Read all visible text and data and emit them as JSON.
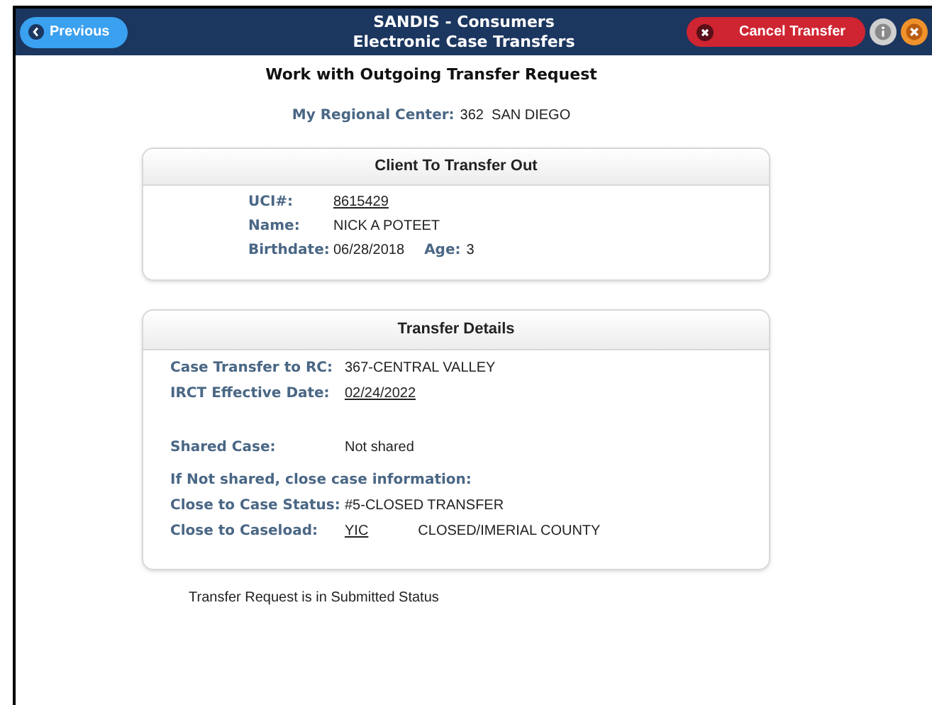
{
  "header": {
    "previous_button": "Previous",
    "title": "SANDIS - Consumers",
    "subtitle": "Electronic Case Transfers",
    "cancel_button": "Cancel Transfer"
  },
  "page_title": "Work with Outgoing Transfer Request",
  "regional_center": {
    "label": "My Regional Center:",
    "value": "362  SAN DIEGO"
  },
  "client_card": {
    "title": "Client To Transfer Out",
    "rows": [
      {
        "label": "UCI#:",
        "value": "8615429",
        "kind": "link"
      },
      {
        "label": "Name:",
        "value": "NICK A POTEET",
        "kind": "text"
      },
      {
        "label": "Birthdate:",
        "value": "06/28/2018",
        "kind": "text",
        "extra_label": "Age:",
        "extra_value": "3"
      }
    ]
  },
  "details_card": {
    "title": "Transfer Details",
    "rows": [
      {
        "kind": "text",
        "label": "Case Transfer to RC:",
        "value": "367-CENTRAL VALLEY"
      },
      {
        "kind": "link",
        "label": "IRCT Effective Date:",
        "value": "02/24/2022"
      },
      {
        "kind": "spacer"
      },
      {
        "kind": "text",
        "label": "Shared Case:",
        "value": "Not shared"
      },
      {
        "kind": "heading",
        "label": "If Not shared, close case information:"
      },
      {
        "kind": "text",
        "label": "Close to Case Status:",
        "value": "#5-CLOSED TRANSFER"
      },
      {
        "kind": "link",
        "label": "Close to Caseload:",
        "value": "YIC",
        "extra_value": "CLOSED/IMERIAL COUNTY"
      }
    ]
  },
  "status_message": "Transfer Request is in Submitted Status"
}
